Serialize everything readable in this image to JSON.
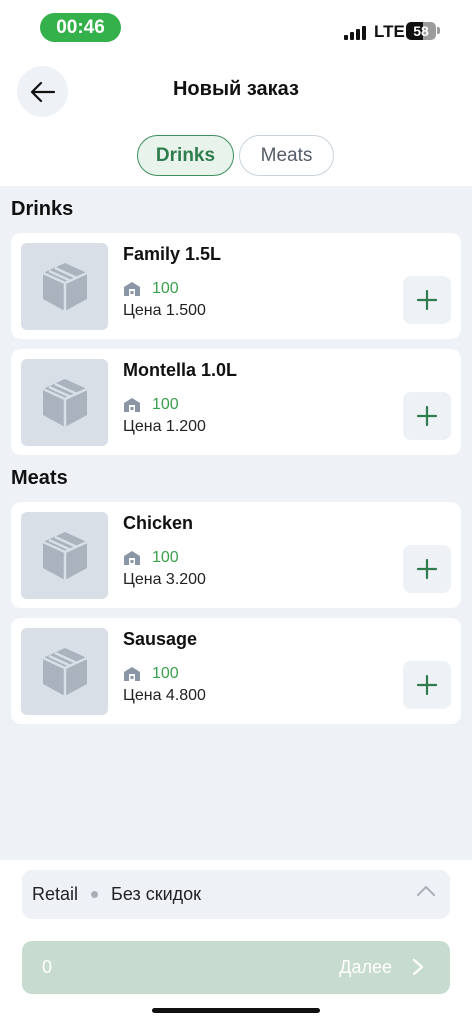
{
  "status_bar": {
    "time": "00:46",
    "network": "LTE",
    "battery": "58"
  },
  "header": {
    "title": "Новый заказ",
    "back_icon": "arrow-left-icon"
  },
  "tabs": [
    {
      "label": "Drinks",
      "active": true
    },
    {
      "label": "Meats",
      "active": false
    }
  ],
  "sections": [
    {
      "title": "Drinks",
      "items": [
        {
          "name": "Family 1.5L",
          "stock": "100",
          "price": "Цена 1.500"
        },
        {
          "name": "Montella 1.0L",
          "stock": "100",
          "price": "Цена 1.200"
        }
      ]
    },
    {
      "title": "Meats",
      "items": [
        {
          "name": "Chicken",
          "stock": "100",
          "price": "Цена 3.200"
        },
        {
          "name": "Sausage",
          "stock": "100",
          "price": "Цена 4.800"
        }
      ]
    }
  ],
  "footer": {
    "price_type": "Retail",
    "discount": "Без скидок",
    "total": "0",
    "next_label": "Далее"
  },
  "colors": {
    "accent": "#34b14a",
    "tab_active_border": "#3f8f5e",
    "stock_green": "#3aa04d",
    "background": "#eef2f7",
    "next_disabled": "#c7dccf"
  }
}
